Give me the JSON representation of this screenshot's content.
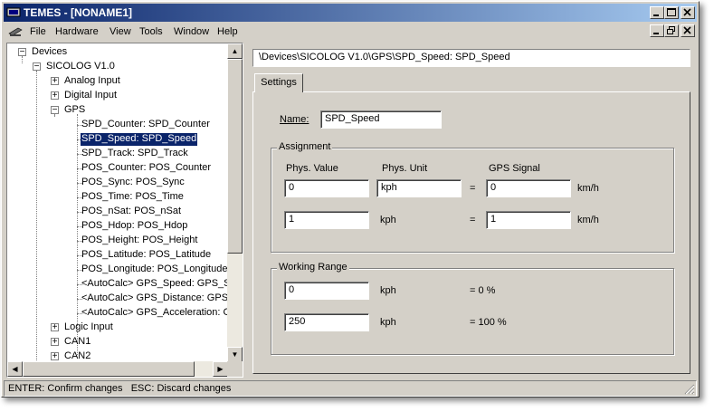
{
  "window": {
    "title": "TEMES - [NONAME1]"
  },
  "menubar": {
    "items": [
      "File",
      "Hardware",
      "View",
      "Tools",
      "Window",
      "Help"
    ]
  },
  "tree": {
    "root": "Devices",
    "device": "SICOLOG V1.0",
    "groups": {
      "analog": "Analog Input",
      "digital": "Digital Input",
      "gps": "GPS",
      "logic": "Logic Input",
      "can1": "CAN1",
      "can2": "CAN2"
    },
    "gps_items": [
      "SPD_Counter: SPD_Counter",
      "SPD_Speed: SPD_Speed",
      "SPD_Track: SPD_Track",
      "POS_Counter: POS_Counter",
      "POS_Sync: POS_Sync",
      "POS_Time: POS_Time",
      "POS_nSat: POS_nSat",
      "POS_Hdop: POS_Hdop",
      "POS_Height: POS_Height",
      "POS_Latitude: POS_Latitude",
      "POS_Longitude: POS_Longitude",
      "<AutoCalc> GPS_Speed: GPS_Sp",
      "<AutoCalc> GPS_Distance: GPS_",
      "<AutoCalc> GPS_Acceleration: GF"
    ],
    "selected_index": 1
  },
  "path": "\\Devices\\SICOLOG V1.0\\GPS\\SPD_Speed: SPD_Speed",
  "tabs": {
    "settings": "Settings"
  },
  "settings": {
    "name_label": "Name:",
    "name_value": "SPD_Speed",
    "assignment": {
      "title": "Assignment",
      "col_phys_value": "Phys. Value",
      "col_phys_unit": "Phys. Unit",
      "col_gps_signal": "GPS Signal",
      "row1": {
        "phys_value": "0",
        "phys_unit": "kph",
        "eq": "=",
        "gps_signal": "0",
        "gps_unit": "km/h"
      },
      "row2": {
        "phys_value": "1",
        "phys_unit": "kph",
        "eq": "=",
        "gps_signal": "1",
        "gps_unit": "km/h"
      }
    },
    "working_range": {
      "title": "Working Range",
      "row1": {
        "value": "0",
        "unit": "kph",
        "percent": "= 0 %"
      },
      "row2": {
        "value": "250",
        "unit": "kph",
        "percent": "= 100 %"
      }
    }
  },
  "statusbar": {
    "text": "ENTER: Confirm changes   ESC: Discard changes"
  },
  "colors": {
    "title_gradient_start": "#0a246a",
    "title_gradient_end": "#a6caf0",
    "face": "#d4d0c8",
    "selection": "#0a246a"
  },
  "icons": {
    "app": "app-icon",
    "minimize": "minimize-icon",
    "maximize": "maximize-icon",
    "close": "close-icon",
    "restore": "restore-icon"
  }
}
